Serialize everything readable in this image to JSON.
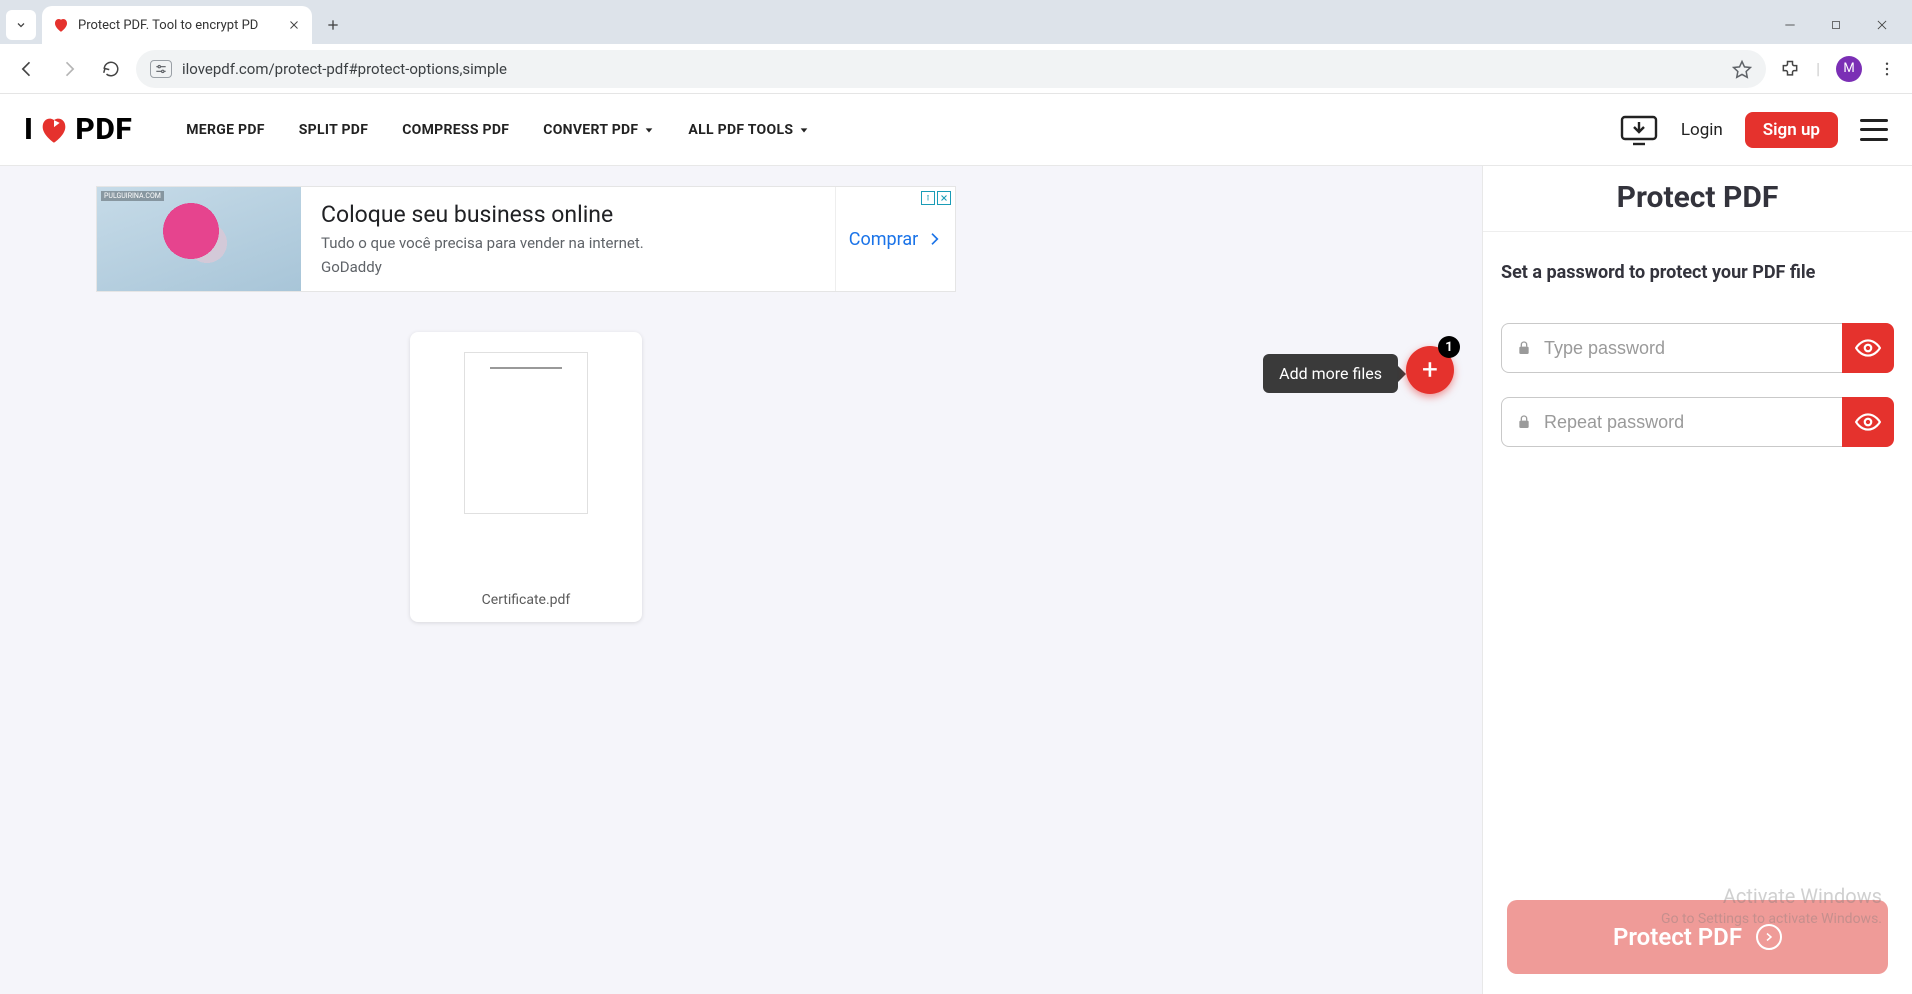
{
  "browser": {
    "tab_title": "Protect PDF. Tool to encrypt PD",
    "url": "ilovepdf.com/protect-pdf#protect-options,simple",
    "avatar_letter": "M"
  },
  "nav": {
    "logo_prefix": "I",
    "logo_suffix": "PDF",
    "links": {
      "merge": "MERGE PDF",
      "split": "SPLIT PDF",
      "compress": "COMPRESS PDF",
      "convert": "CONVERT PDF",
      "all": "ALL PDF TOOLS"
    },
    "login": "Login",
    "signup": "Sign up"
  },
  "ad": {
    "watermark": "PULGUIRINA.COM",
    "title": "Coloque seu business online",
    "subtitle": "Tudo o que você precisa para vender na internet.",
    "brand": "GoDaddy",
    "cta": "Comprar"
  },
  "files": {
    "add_more": "Add more files",
    "count": "1",
    "file_name": "Certificate.pdf"
  },
  "sidebar": {
    "title": "Protect PDF",
    "instruction": "Set a password to protect your PDF file",
    "password_placeholder": "Type password",
    "repeat_placeholder": "Repeat password",
    "action_label": "Protect PDF"
  },
  "watermark": {
    "line1": "Activate Windows",
    "line2": "Go to Settings to activate Windows."
  }
}
